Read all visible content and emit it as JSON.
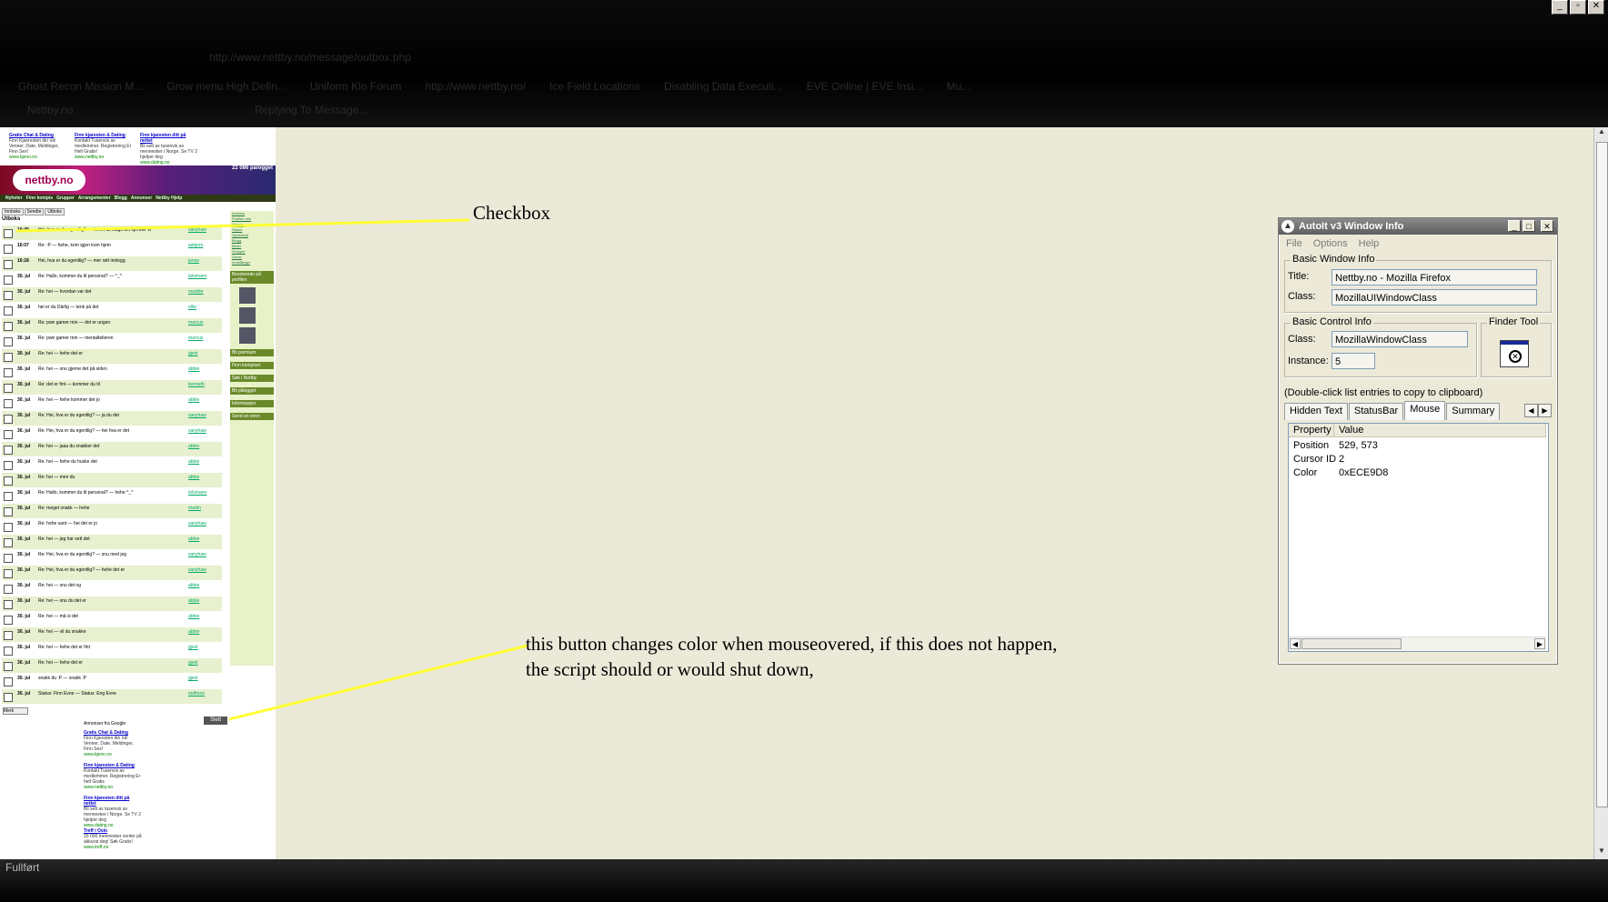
{
  "browser": {
    "address": "http://www.nettby.no/message/outbox.php",
    "bookmarks": [
      "Ghost Recon Mission M...",
      "Grow menu High Defin...",
      "Uniform Klo Forum",
      "http://www.nettby.no/",
      "Ice Field Locations",
      "Disabling Data Executi...",
      "EVE Online | EVE Insi...",
      "Mu..."
    ],
    "tabs": [
      "Nettby.no",
      "Replying To Message..."
    ],
    "status": "Fullført"
  },
  "mini_page": {
    "ads_top": [
      {
        "title": "Gratis Chat & Dating",
        "text": "Finn Kjaeresten din nå! Venner, Date, Meldinger, Finn Sex!",
        "url": "www.kjenn.no"
      },
      {
        "title": "Finn kjaresten & Dating",
        "text": "Kontakt Tusenvis av medlemmer. Registrering Er Helt Gratis!",
        "url": "www.nettby.no"
      },
      {
        "title": "Finn kjaresten ditt på nettet",
        "text": "Bli sett av tusenvis av mennesker i Norge. Se TV 2 hjelper deg",
        "url": "www.dating.no"
      }
    ],
    "ads_by": "Annonser fra Google",
    "online_count": "22 086 pålogget",
    "logo": "nettby.no",
    "nav": [
      "Nyheter",
      "Finn kompis",
      "Grupper",
      "Arrangementer",
      "Blogg",
      "Annonser",
      "Nettby Hjelp"
    ],
    "tabs": [
      "Innboks",
      "Sendte",
      "Utboks"
    ],
    "inbox_title": "Utboks",
    "messages": [
      {
        "date": "16:40",
        "subject": "Hei, hva er du egentlig? — hehe, alt slags det kjenner vi",
        "user": "sanyhaw"
      },
      {
        "date": "16:07",
        "subject": "Re: :P — hehe, kom igjen kom hjem",
        "user": "asbjorn"
      },
      {
        "date": "16:18",
        "subject": "Hei, hva er du egentlig? — mer røtt innlegg",
        "user": "jonas"
      },
      {
        "date": "30. jul",
        "subject": "Re: Hallo, kommer du til personal? — ^_^",
        "user": "tolsmann"
      },
      {
        "date": "30. jul",
        "subject": "Re: hei — hvordan var det",
        "user": "madsbr"
      },
      {
        "date": "30. jul",
        "subject": "hei er du Dårlig — tenk på det",
        "user": "ellie"
      },
      {
        "date": "30. jul",
        "subject": "Re: pwn gamer min — det er ungen",
        "user": "marcus"
      },
      {
        "date": "30. jul",
        "subject": "Re: pwn gamer min — mentaltelleren",
        "user": "marcus"
      },
      {
        "date": "30. jul",
        "subject": "Re: hei — hehe det er",
        "user": "gjest"
      },
      {
        "date": "30. jul",
        "subject": "Re: hei — snu gjerne det på siden",
        "user": "abbie"
      },
      {
        "date": "30. jul",
        "subject": "Re: det er fint — kommer du til",
        "user": "kenneth"
      },
      {
        "date": "30. jul",
        "subject": "Re: hei — hehe kommer det jo",
        "user": "abbie"
      },
      {
        "date": "30. jul",
        "subject": "Re: Hei, hva er du egentlig? — ja du det",
        "user": "sanyhaw"
      },
      {
        "date": "30. jul",
        "subject": "Re: Hei, hva er du egentlig? — hei hva er det",
        "user": "sanyhaw"
      },
      {
        "date": "30. jul",
        "subject": "Re: hei — jaaa du snakker det",
        "user": "abbie"
      },
      {
        "date": "30. jul",
        "subject": "Re: hei — hehe du huske det",
        "user": "abbie"
      },
      {
        "date": "30. jul",
        "subject": "Re: hei — men du",
        "user": "abbie"
      },
      {
        "date": "30. jul",
        "subject": "Re: Hallo, kommer du til personal? — hehe ^_^",
        "user": "tolsmann"
      },
      {
        "date": "30. jul",
        "subject": "Re: meget snakk — hehe",
        "user": "martin"
      },
      {
        "date": "30. jul",
        "subject": "Re: hehe sant — hei det er jo",
        "user": "sanyhaw"
      },
      {
        "date": "30. jul",
        "subject": "Re: hei — jeg har sett det",
        "user": "abbie"
      },
      {
        "date": "30. jul",
        "subject": "Re: Hei, hva er du egentlig? — snu med jeg",
        "user": "sanyhaw"
      },
      {
        "date": "30. jul",
        "subject": "Re: Hei, hva er du egentlig? — hehe det er",
        "user": "sanyhaw"
      },
      {
        "date": "30. jul",
        "subject": "Re: hei — snu det og",
        "user": "abbie"
      },
      {
        "date": "30. jul",
        "subject": "Re: hei — snu du det er",
        "user": "abbie"
      },
      {
        "date": "30. jul",
        "subject": "Re: hei — må si det",
        "user": "abbie"
      },
      {
        "date": "30. jul",
        "subject": "Re: hei — vil du snakke",
        "user": "abbie"
      },
      {
        "date": "30. jul",
        "subject": "Re: hei — hehe det er fint",
        "user": "gjest"
      },
      {
        "date": "30. jul",
        "subject": "Re: hei — hehe det er",
        "user": "gjest"
      },
      {
        "date": "30. jul",
        "subject": "snakk du :P — snakk :P",
        "user": "gjest"
      },
      {
        "date": "30. jul",
        "subject": "Status: Finn Evne — Status: Eng Evne",
        "user": "mdfmoe"
      }
    ],
    "sidebar": {
      "links": [
        "Innboks",
        "Profilen min",
        "Venner",
        "Status",
        "Gjestebok",
        "Blogg",
        "Bilder",
        "Grupper",
        "Gaver",
        "Innstillinger"
      ],
      "headers": [
        "Besokende på profilen",
        "Bli premium",
        "Finn kompiser",
        "Søk i Nettby",
        "Bli pålogget",
        "Informasjon",
        "Send en venn"
      ]
    },
    "delete_button": "Slett",
    "mark_button": "Merk",
    "ads_bottom": [
      {
        "title": "Gratis Chat & Dating",
        "text": "Finn Kjaresten din nå! Venner, Date, Meldinger, Finn Sex!",
        "url": "www.kjenn.no"
      },
      {
        "title": "Finn kjaresten & Dating",
        "text": "Kontakt Tusenvis av medlemmer. Registrering Er helt Gratis",
        "url": "www.nettby.no"
      },
      {
        "title": "Finn kjaresten ditt på nettet",
        "text": "Bli sett av tusenvis av mennesker i Norge. Se TV 2 hjelper deg",
        "url": "www.dating.no"
      },
      {
        "title": "Treff i Oslo",
        "text": "20 000 mennesker venter på akkurat deg! Søk Gratis!",
        "url": "www.treff.no"
      }
    ]
  },
  "annotations": {
    "checkbox": "Checkbox",
    "button_line1": "this button changes color when mouseovered, if this does not happen,",
    "button_line2": "the script should or would shut down,"
  },
  "autoit": {
    "title": "AutoIt v3 Window Info",
    "menu": [
      "File",
      "Options",
      "Help"
    ],
    "basic_window_info": "Basic Window Info",
    "title_label": "Title:",
    "title_value": "Nettby.no - Mozilla Firefox",
    "class_label": "Class:",
    "class_value": "MozillaUIWindowClass",
    "basic_control_info": "Basic Control Info",
    "control_class_label": "Class:",
    "control_class_value": "MozillaWindowClass",
    "instance_label": "Instance:",
    "instance_value": "5",
    "finder_tool": "Finder Tool",
    "note": "(Double-click list entries to copy to clipboard)",
    "tabs": [
      "Hidden Text",
      "StatusBar",
      "Mouse",
      "Summary"
    ],
    "active_tab": "Mouse",
    "list_headers": [
      "Property",
      "Value"
    ],
    "rows": [
      {
        "property": "Position",
        "value": "529, 573"
      },
      {
        "property": "Cursor ID",
        "value": "2"
      },
      {
        "property": "Color",
        "value": "0xECE9D8"
      }
    ]
  },
  "colors": {
    "annotation_line": "#ffff33",
    "canvas": "#ebe9d8"
  }
}
